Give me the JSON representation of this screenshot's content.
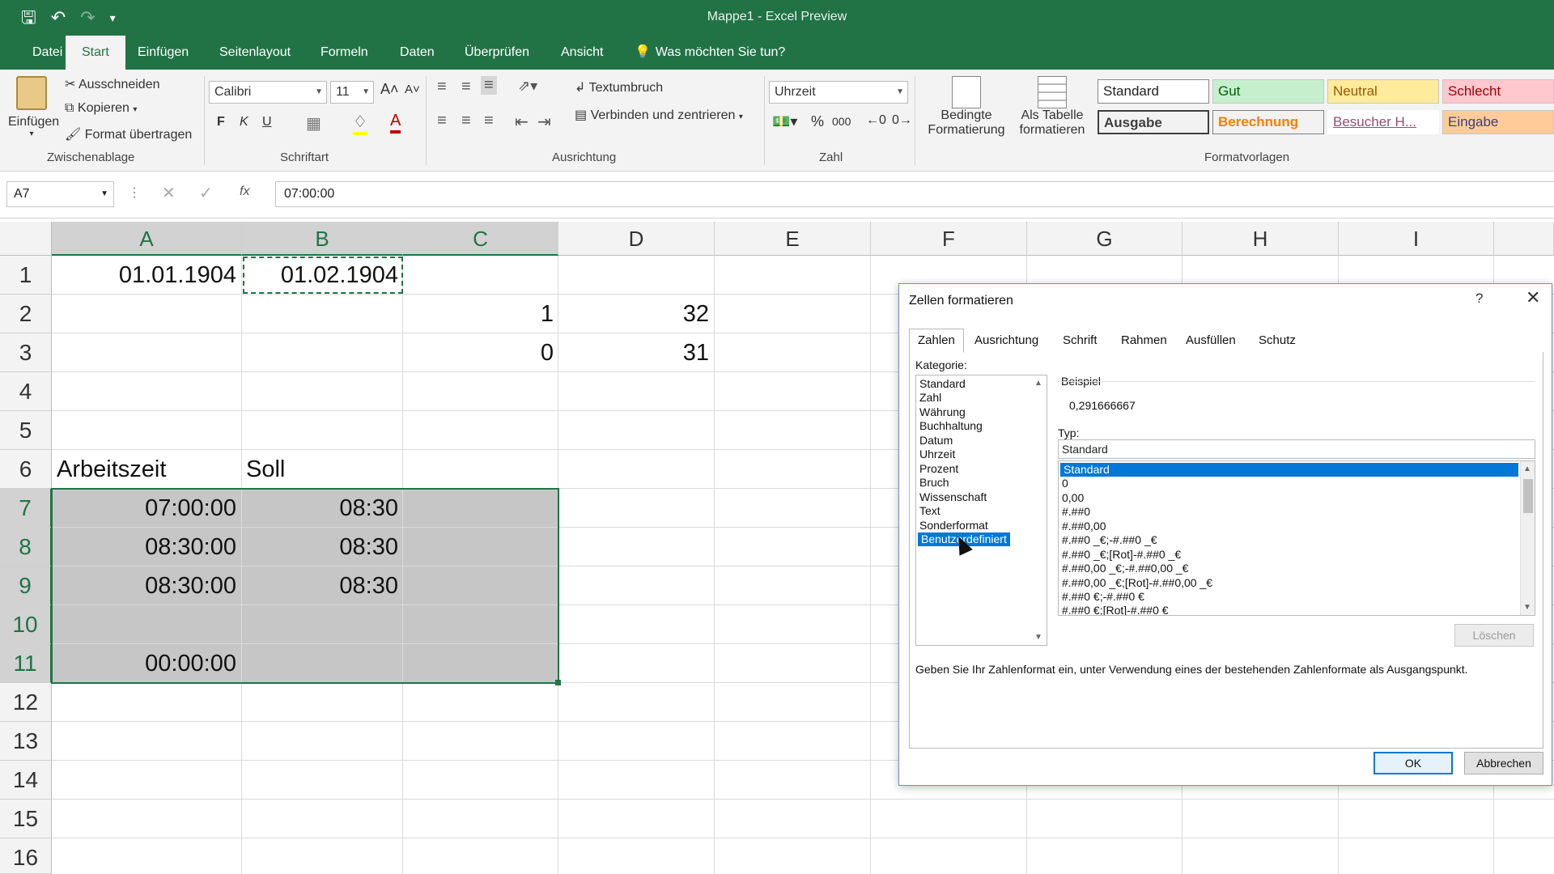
{
  "app": {
    "title": "Mappe1 - Excel Preview"
  },
  "qat": {
    "save_icon": "save-icon",
    "undo_icon": "undo-icon",
    "redo_icon": "redo-icon"
  },
  "menu": {
    "tabs": [
      "Datei",
      "Start",
      "Einfügen",
      "Seitenlayout",
      "Formeln",
      "Daten",
      "Überprüfen",
      "Ansicht"
    ],
    "active": "Start",
    "search": "Was möchten Sie tun?"
  },
  "ribbon": {
    "clipboard": {
      "paste": "Einfügen",
      "cut": "Ausschneiden",
      "copy": "Kopieren",
      "format_painter": "Format übertragen",
      "group": "Zwischenablage"
    },
    "font": {
      "name": "Calibri",
      "size": "11",
      "bold": "F",
      "italic": "K",
      "underline": "U",
      "group": "Schriftart"
    },
    "alignment": {
      "wrap": "Textumbruch",
      "merge": "Verbinden und zentrieren",
      "group": "Ausrichtung"
    },
    "number": {
      "format": "Uhrzeit",
      "percent": "%",
      "thousands": "000",
      "group": "Zahl"
    },
    "styles_buttons": {
      "conditional": "Bedingte",
      "conditional2": "Formatierung",
      "table": "Als Tabelle",
      "table2": "formatieren"
    },
    "styles": {
      "group": "Formatvorlagen",
      "standard": "Standard",
      "gut": "Gut",
      "neutral": "Neutral",
      "schlecht": "Schlecht",
      "ausgabe": "Ausgabe",
      "berechnung": "Berechnung",
      "besucher": "Besucher H...",
      "eingabe": "Eingabe",
      "colors": {
        "gut_bg": "#c6efce",
        "gut_fg": "#006100",
        "neutral_bg": "#ffeb9c",
        "neutral_fg": "#9c5700",
        "schlecht_bg": "#ffc7ce",
        "schlecht_fg": "#9c0006",
        "berechnung_fg": "#fa7d00",
        "eingabe_bg": "#ffcc99",
        "ausgabe_bg": "#f2f2f2"
      }
    }
  },
  "formula_bar": {
    "name_box": "A7",
    "fx": "fx",
    "value": "07:00:00"
  },
  "grid": {
    "columns": [
      "A",
      "B",
      "C",
      "D",
      "E",
      "F",
      "G",
      "H",
      "I"
    ],
    "rows": [
      "1",
      "2",
      "3",
      "4",
      "5",
      "6",
      "7",
      "8",
      "9",
      "10",
      "11",
      "12",
      "13",
      "14",
      "15",
      "16"
    ],
    "cells": {
      "A1": "01.01.1904",
      "B1": "01.02.1904",
      "C2": "1",
      "D2": "32",
      "C3": "0",
      "D3": "31",
      "A6": "Arbeitszeit",
      "B6": "Soll",
      "A7": "07:00:00",
      "B7": "08:30",
      "A8": "08:30:00",
      "B8": "08:30",
      "A9": "08:30:00",
      "B9": "08:30",
      "A11": "00:00:00"
    }
  },
  "dialog": {
    "title": "Zellen formatieren",
    "help": "?",
    "close": "✕",
    "tabs": [
      "Zahlen",
      "Ausrichtung",
      "Schrift",
      "Rahmen",
      "Ausfüllen",
      "Schutz"
    ],
    "category_label": "Kategorie:",
    "categories": [
      "Standard",
      "Zahl",
      "Währung",
      "Buchhaltung",
      "Datum",
      "Uhrzeit",
      "Prozent",
      "Bruch",
      "Wissenschaft",
      "Text",
      "Sonderformat",
      "Benutzerdefiniert"
    ],
    "selected_category": "Benutzerdefiniert",
    "sample_label": "Beispiel",
    "sample_value": "0,291666667",
    "type_label": "Typ:",
    "type_value": "Standard",
    "type_list": [
      "Standard",
      "0",
      "0,00",
      "#.##0",
      "#.##0,00",
      "#.##0 _€;-#.##0 _€",
      "#.##0 _€;[Rot]-#.##0 _€",
      "#.##0,00 _€;-#.##0,00 _€",
      "#.##0,00 _€;[Rot]-#.##0,00 _€",
      "#.##0 €;-#.##0 €",
      "#.##0 €;[Rot]-#.##0 €"
    ],
    "delete_button": "Löschen",
    "hint": "Geben Sie Ihr Zahlenformat ein, unter Verwendung eines der bestehenden Zahlenformate als Ausgangspunkt.",
    "ok": "OK",
    "cancel": "Abbrechen"
  }
}
